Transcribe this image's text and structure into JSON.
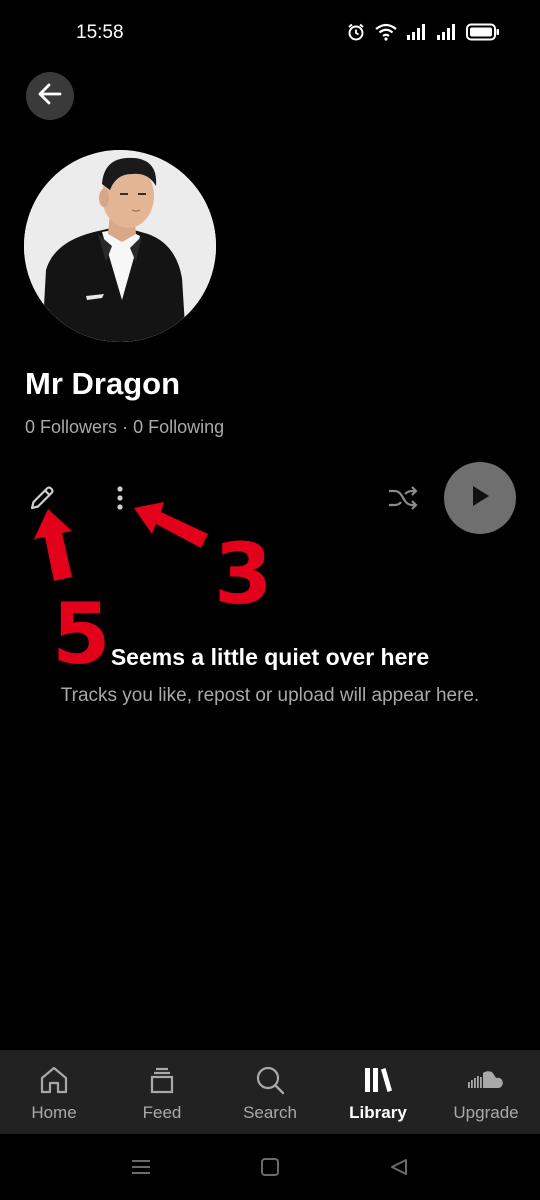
{
  "status_bar": {
    "time": "15:58",
    "icons": [
      "alarm-icon",
      "wifi-icon",
      "signal-icon",
      "signal-icon",
      "battery-icon"
    ]
  },
  "header": {
    "back_icon": "arrow-left-icon"
  },
  "profile": {
    "name": "Mr Dragon",
    "followers": "0 Followers",
    "separator": "·",
    "following": "0 Following"
  },
  "actions": {
    "edit_icon": "pencil-icon",
    "more_icon": "more-vertical-icon",
    "shuffle_icon": "shuffle-icon",
    "play_icon": "play-icon"
  },
  "annotations": {
    "label_3": "3",
    "label_5": "5",
    "color": "#e3001b"
  },
  "empty_state": {
    "title": "Seems a little quiet over here",
    "subtitle": "Tracks you like, repost or upload will appear here."
  },
  "bottom_nav": {
    "items": [
      {
        "label": "Home",
        "icon": "home-icon"
      },
      {
        "label": "Feed",
        "icon": "feed-icon"
      },
      {
        "label": "Search",
        "icon": "search-icon"
      },
      {
        "label": "Library",
        "icon": "library-icon",
        "active": true
      },
      {
        "label": "Upgrade",
        "icon": "soundcloud-icon"
      }
    ]
  },
  "system_nav": {
    "icons": [
      "menu-icon",
      "home-square-icon",
      "back-triangle-icon"
    ]
  },
  "colors": {
    "background": "#000000",
    "nav_background": "#222222",
    "muted_text": "#a9a9a9",
    "play_button": "#6f6f6f"
  }
}
